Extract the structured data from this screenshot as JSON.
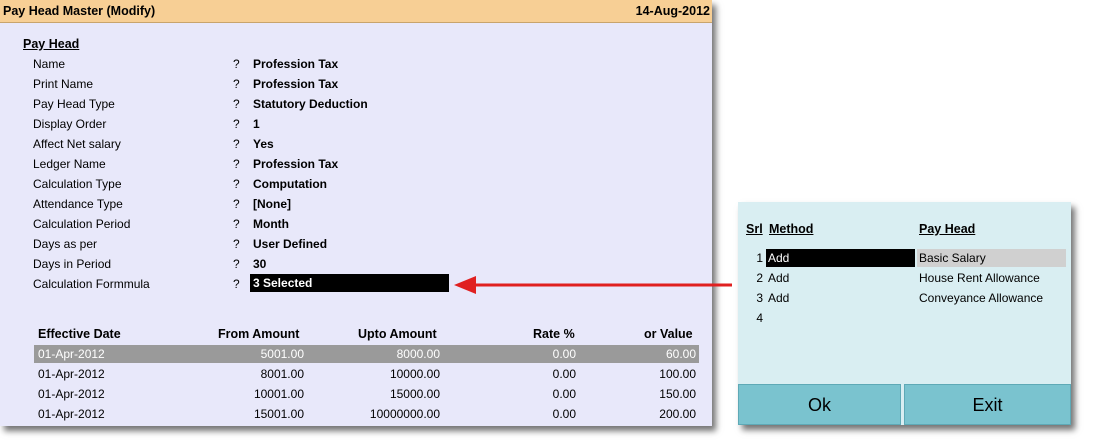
{
  "window": {
    "title": "Pay Head Master (Modify)",
    "date": "14-Aug-2012"
  },
  "section_title": "Pay Head",
  "fields": [
    {
      "label": "Name",
      "sep": "?",
      "value": "Profession Tax"
    },
    {
      "label": "Print Name",
      "sep": "?",
      "value": "Profession Tax"
    },
    {
      "label": "Pay Head Type",
      "sep": "?",
      "value": "Statutory Deduction"
    },
    {
      "label": "Display Order",
      "sep": "?",
      "value": "1"
    },
    {
      "label": "Affect Net salary",
      "sep": "?",
      "value": "Yes"
    },
    {
      "label": "Ledger Name",
      "sep": "?",
      "value": "Profession Tax"
    },
    {
      "label": "Calculation Type",
      "sep": "?",
      "value": "Computation"
    },
    {
      "label": "Attendance Type",
      "sep": "?",
      "value": "[None]"
    },
    {
      "label": "Calculation Period",
      "sep": "?",
      "value": "Month"
    },
    {
      "label": "Days as per",
      "sep": "?",
      "value": "User Defined"
    },
    {
      "label": "Days in Period",
      "sep": "?",
      "value": "30"
    },
    {
      "label": "Calculation Formmula",
      "sep": "?",
      "value": "3 Selected"
    }
  ],
  "table": {
    "headers": [
      "Effective Date",
      "From Amount",
      "Upto Amount",
      "Rate %",
      "or Value"
    ],
    "rows": [
      [
        "01-Apr-2012",
        "5001.00",
        "8000.00",
        "0.00",
        "60.00"
      ],
      [
        "01-Apr-2012",
        "8001.00",
        "10000.00",
        "0.00",
        "100.00"
      ],
      [
        "01-Apr-2012",
        "10001.00",
        "15000.00",
        "0.00",
        "150.00"
      ],
      [
        "01-Apr-2012",
        "15001.00",
        "10000000.00",
        "0.00",
        "200.00"
      ]
    ]
  },
  "arrow_color": "#e02020",
  "subform": {
    "headers": {
      "srl": "Srl",
      "method": "Method",
      "pay_head": "Pay Head"
    },
    "rows": [
      {
        "srl": "1",
        "method": "Add",
        "pay_head": "Basic Salary"
      },
      {
        "srl": "2",
        "method": "Add",
        "pay_head": "House Rent Allowance"
      },
      {
        "srl": "3",
        "method": "Add",
        "pay_head": "Conveyance Allowance"
      },
      {
        "srl": "4",
        "method": "",
        "pay_head": ""
      }
    ],
    "buttons": {
      "ok": "Ok",
      "exit": "Exit"
    }
  },
  "colors": {
    "title_bar": "#f7cf95",
    "form_bg": "#e8e8fa",
    "subform_bg": "#d9eef2",
    "button_bg": "#7ac3cf",
    "highlight_row": "#9a9a9a"
  }
}
